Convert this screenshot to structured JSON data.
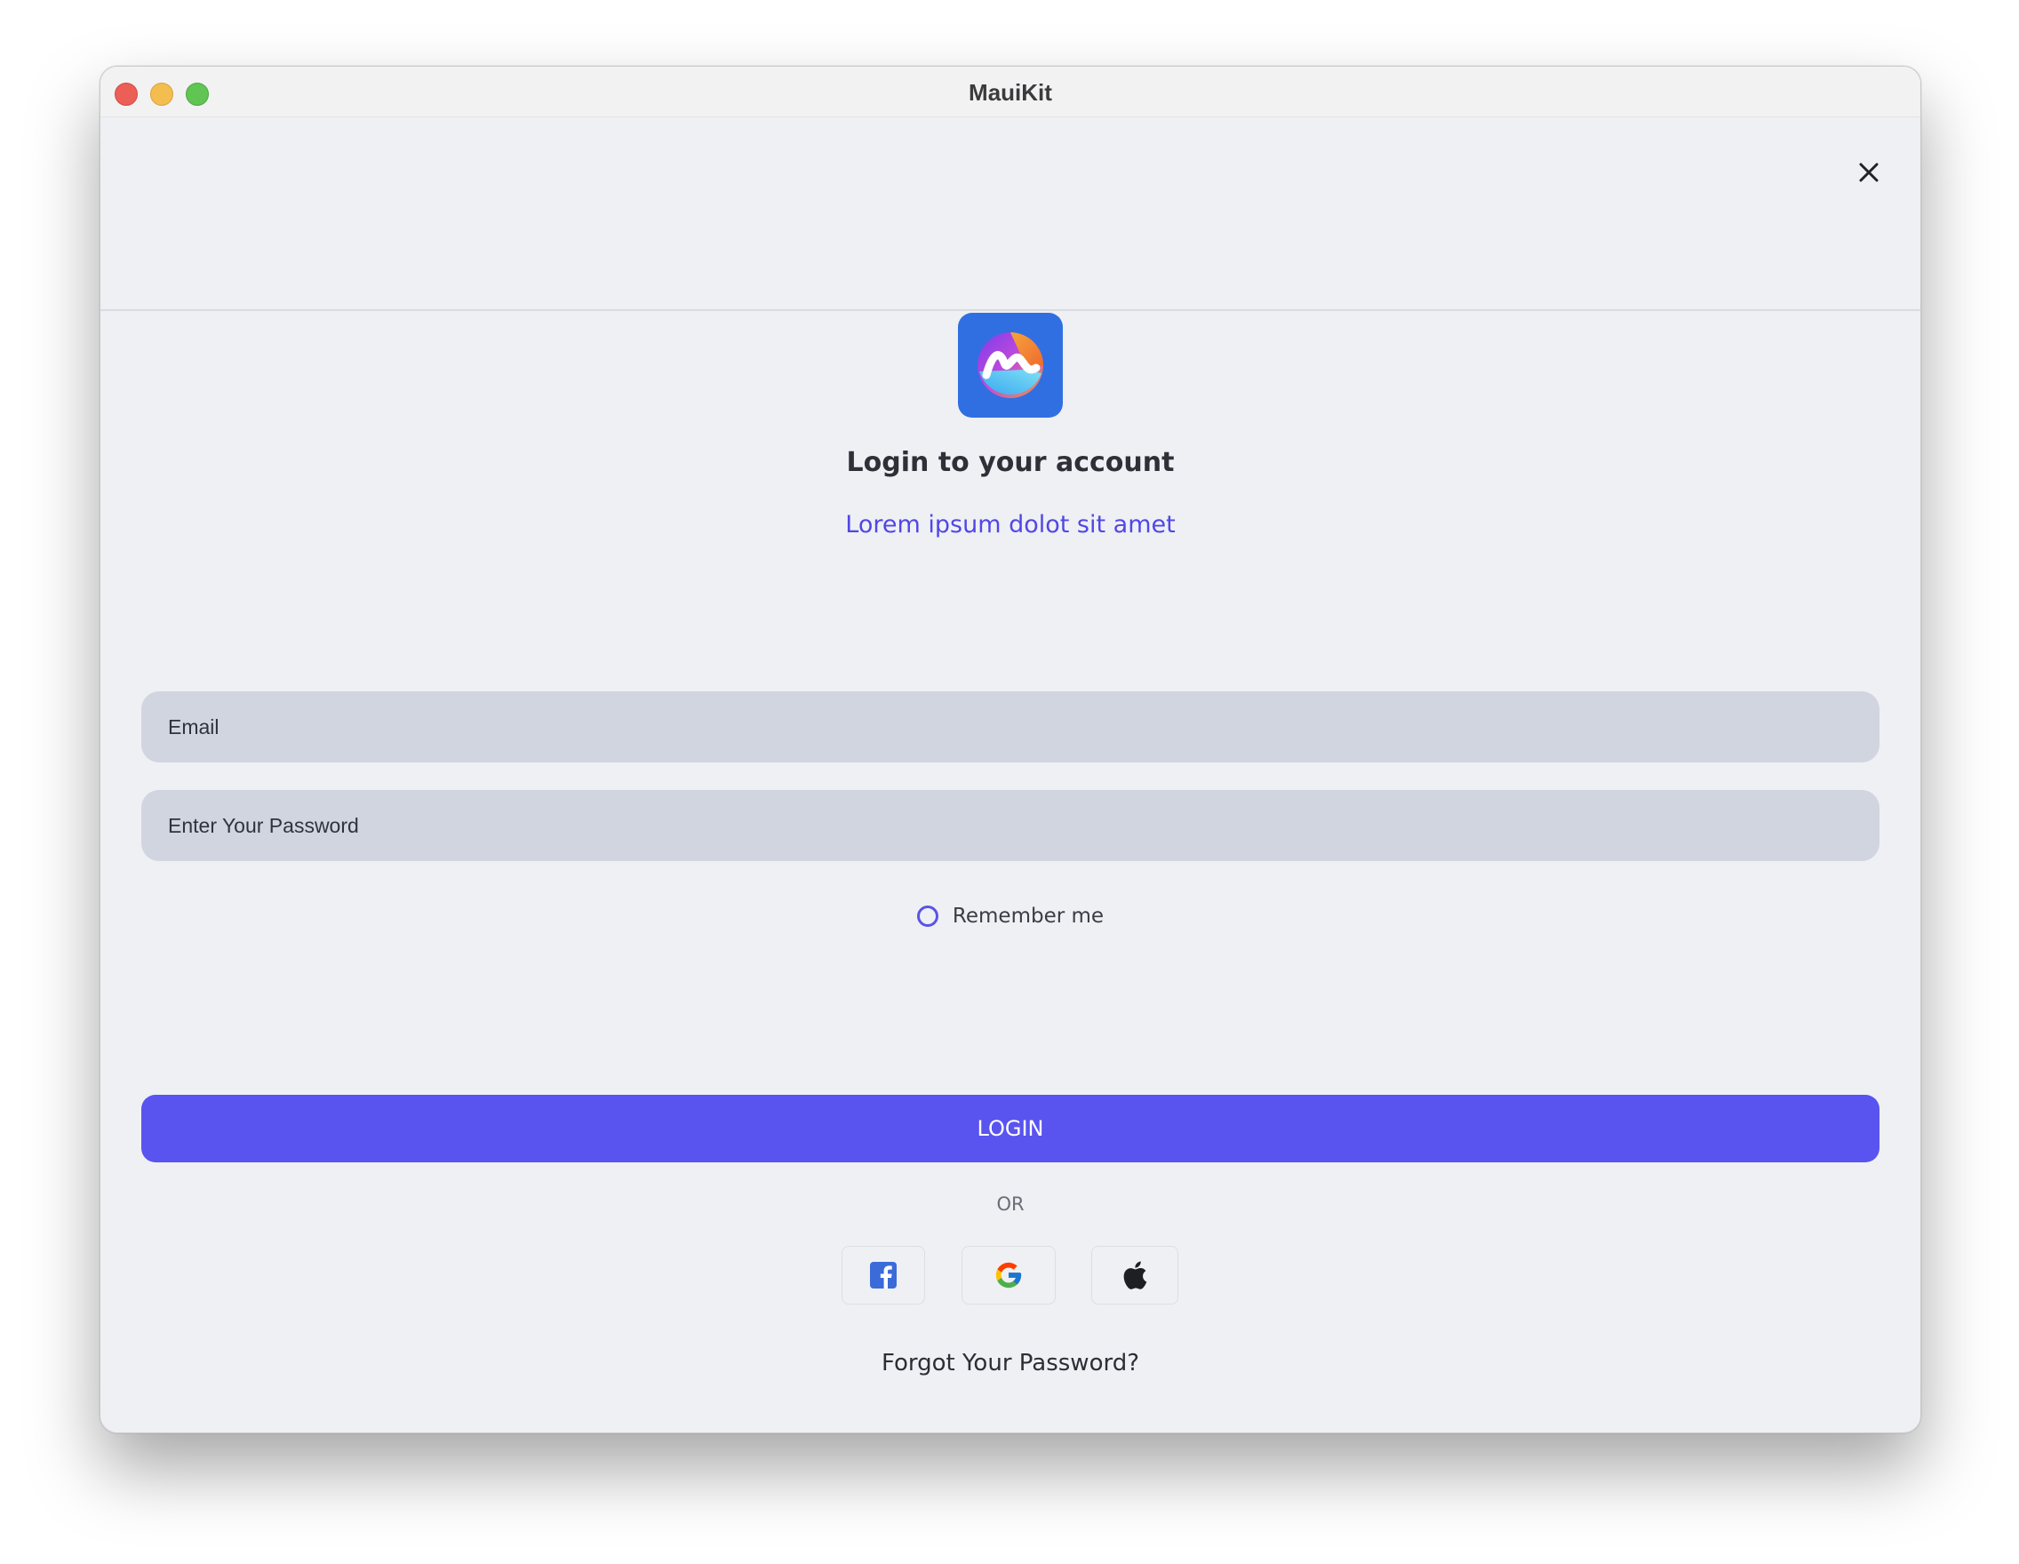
{
  "window": {
    "title": "MauiKit"
  },
  "header": {
    "close_icon": "close-icon"
  },
  "login": {
    "heading": "Login to your account",
    "subheading": "Lorem ipsum dolot sit amet",
    "email_placeholder": "Email",
    "password_placeholder": "Enter Your Password",
    "remember_label": "Remember me",
    "remember_checked": false,
    "login_button": "LOGIN",
    "or_label": "OR",
    "forgot_link": "Forgot Your Password?"
  },
  "social": {
    "buttons": [
      "facebook-icon",
      "google-icon",
      "apple-icon"
    ]
  },
  "colors": {
    "accent": "#5953ef",
    "subheading": "#5147e6",
    "logo_bg": "#2f6fe2",
    "field_bg": "#d0d5e0",
    "window_bg": "#eef0f4"
  }
}
